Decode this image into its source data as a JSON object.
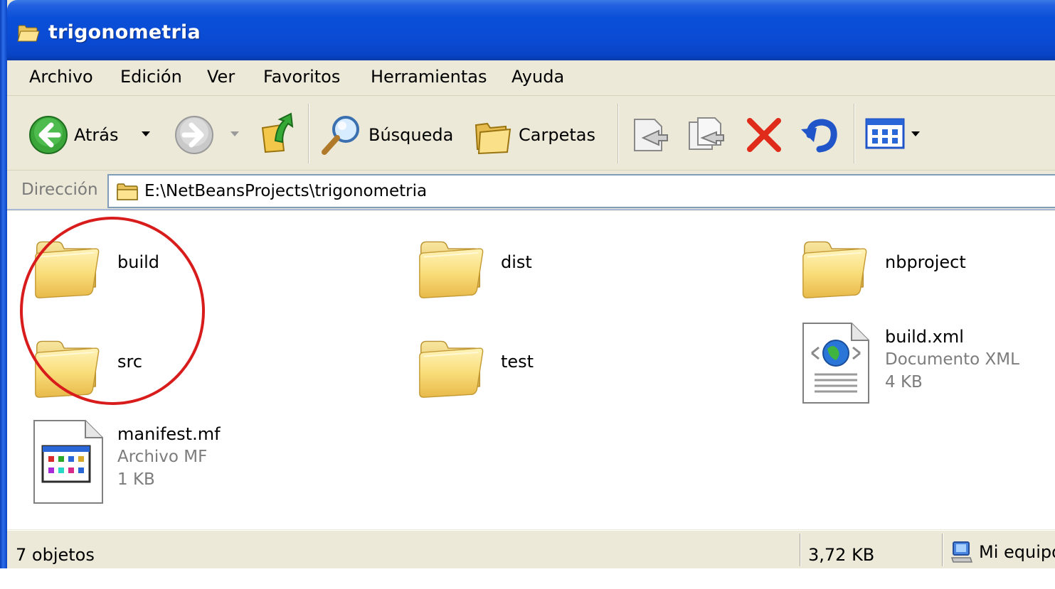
{
  "window": {
    "title": "trigonometria",
    "title_icon": "folder-open-icon"
  },
  "menu": {
    "items": [
      "Archivo",
      "Edición",
      "Ver",
      "Favoritos",
      "Herramientas",
      "Ayuda"
    ]
  },
  "toolbar": {
    "back_label": "Atrás",
    "search_label": "Búsqueda",
    "folders_label": "Carpetas"
  },
  "address": {
    "label": "Dirección",
    "path": "E:\\NetBeansProjects\\trigonometria"
  },
  "files": [
    {
      "name": "build",
      "type": "folder"
    },
    {
      "name": "dist",
      "type": "folder"
    },
    {
      "name": "nbproject",
      "type": "folder"
    },
    {
      "name": "src",
      "type": "folder"
    },
    {
      "name": "test",
      "type": "folder"
    },
    {
      "name": "build.xml",
      "type": "Documento XML",
      "size": "4 KB"
    },
    {
      "name": "manifest.mf",
      "type": "Archivo MF",
      "size": "1 KB"
    }
  ],
  "status": {
    "object_count": "7 objetos",
    "total_size": "3,72 KB",
    "zone": "Mi equipo"
  },
  "colors": {
    "title_bar": "#0a4fd8",
    "annotation_circle": "#d81c1c",
    "folder_yellow": "#f7d76a"
  }
}
